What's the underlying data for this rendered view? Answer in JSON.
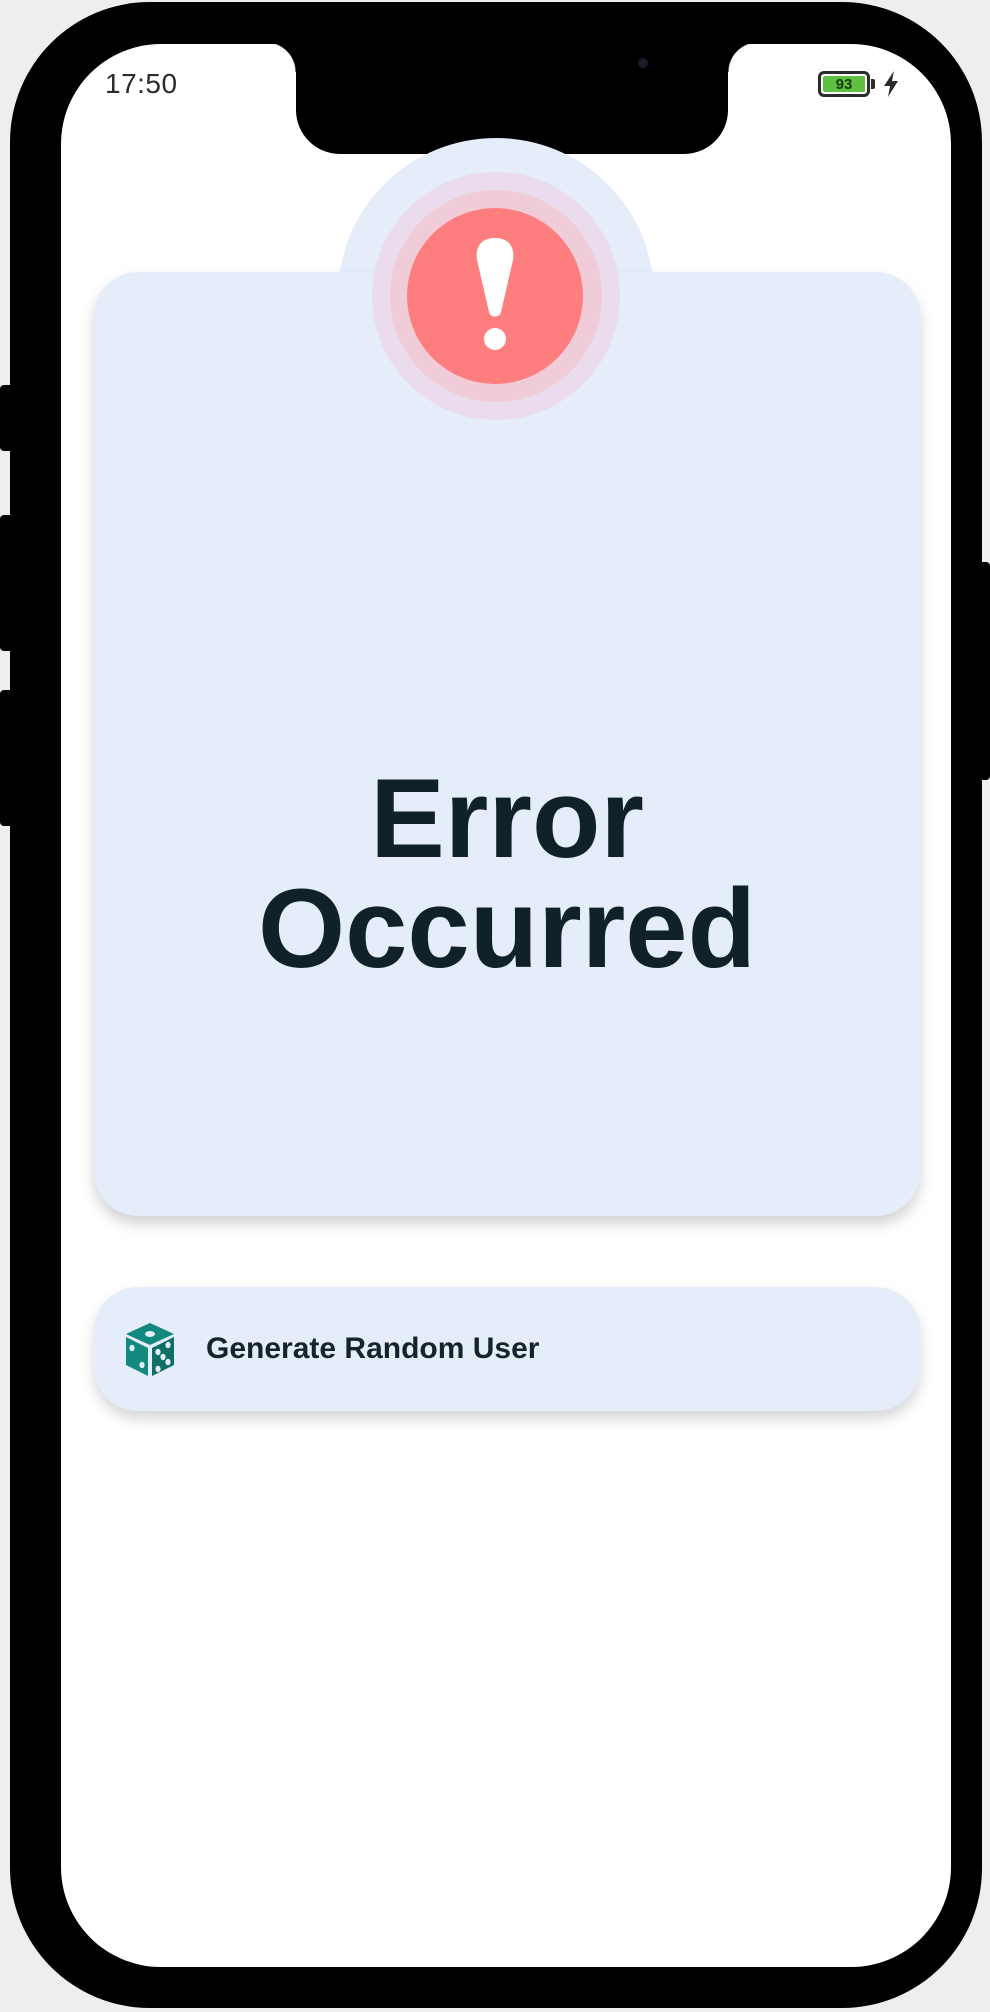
{
  "status_bar": {
    "time": "17:50",
    "battery_level": "93",
    "charging": true
  },
  "error": {
    "icon": "exclamation-icon",
    "title_line1": "Error",
    "title_line2": "Occurred"
  },
  "actions": {
    "generate_label": "Generate Random User",
    "generate_icon": "dice-icon"
  },
  "colors": {
    "card_bg": "#e5edfb",
    "alert_red": "#fe7d7f",
    "dice_teal": "#11897f",
    "text_dark": "#102128",
    "battery_green": "#5ec03e"
  }
}
